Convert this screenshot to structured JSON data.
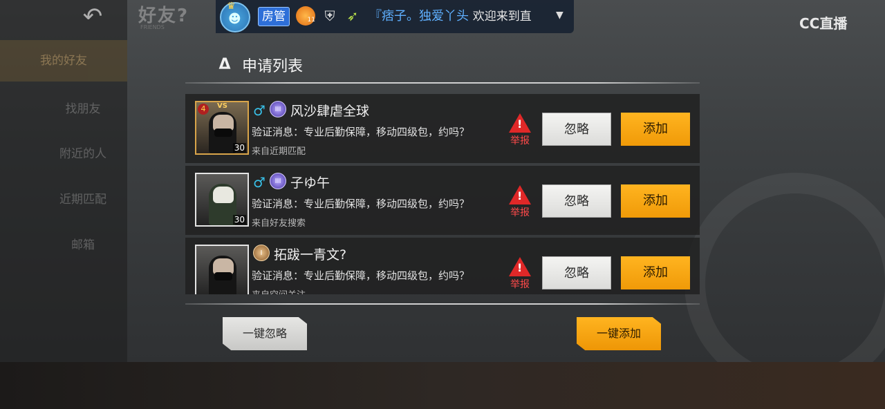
{
  "topbar": {
    "back_icon": "back-arrow-icon",
    "brand_title": "好友",
    "brand_mark": "?",
    "brand_subtitle": "FRIENDS"
  },
  "sidebar": {
    "items": [
      {
        "label": "我的好友"
      },
      {
        "label": "找朋友"
      },
      {
        "label": "附近的人"
      },
      {
        "label": "近期匹配"
      },
      {
        "label": "邮箱"
      }
    ]
  },
  "danmu": {
    "role_badge": "房管",
    "level_badge": "11",
    "nickname": "『痞子。独爱丫头",
    "message": "欢迎来到直",
    "caret": "▼"
  },
  "watermark": {
    "label": "CC直播"
  },
  "panel": {
    "logo": "Δ",
    "title": "申请列表"
  },
  "requests": [
    {
      "name": "风沙肆虐全球",
      "gender": "♂",
      "rank": "III",
      "level": "30",
      "avatar_rank": "4",
      "avatar_tag": "VS",
      "verify": "验证消息：专业后勤保障，移动四级包，约吗？",
      "source": "来自近期匹配",
      "report_label": "举报",
      "ignore_label": "忽略",
      "add_label": "添加"
    },
    {
      "name": "子ゆ午",
      "gender": "♂",
      "rank": "III",
      "level": "30",
      "verify": "验证消息：专业后勤保障，移动四级包，约吗？",
      "source": "来自好友搜索",
      "report_label": "举报",
      "ignore_label": "忽略",
      "add_label": "添加"
    },
    {
      "name": "拓跋一青文?",
      "rank": "I",
      "verify": "验证消息：专业后勤保障，移动四级包，约吗？",
      "source": "来自空间关注",
      "report_label": "举报",
      "ignore_label": "忽略",
      "add_label": "添加"
    }
  ],
  "actions": {
    "ignore_all": "一键忽略",
    "add_all": "一键添加"
  }
}
